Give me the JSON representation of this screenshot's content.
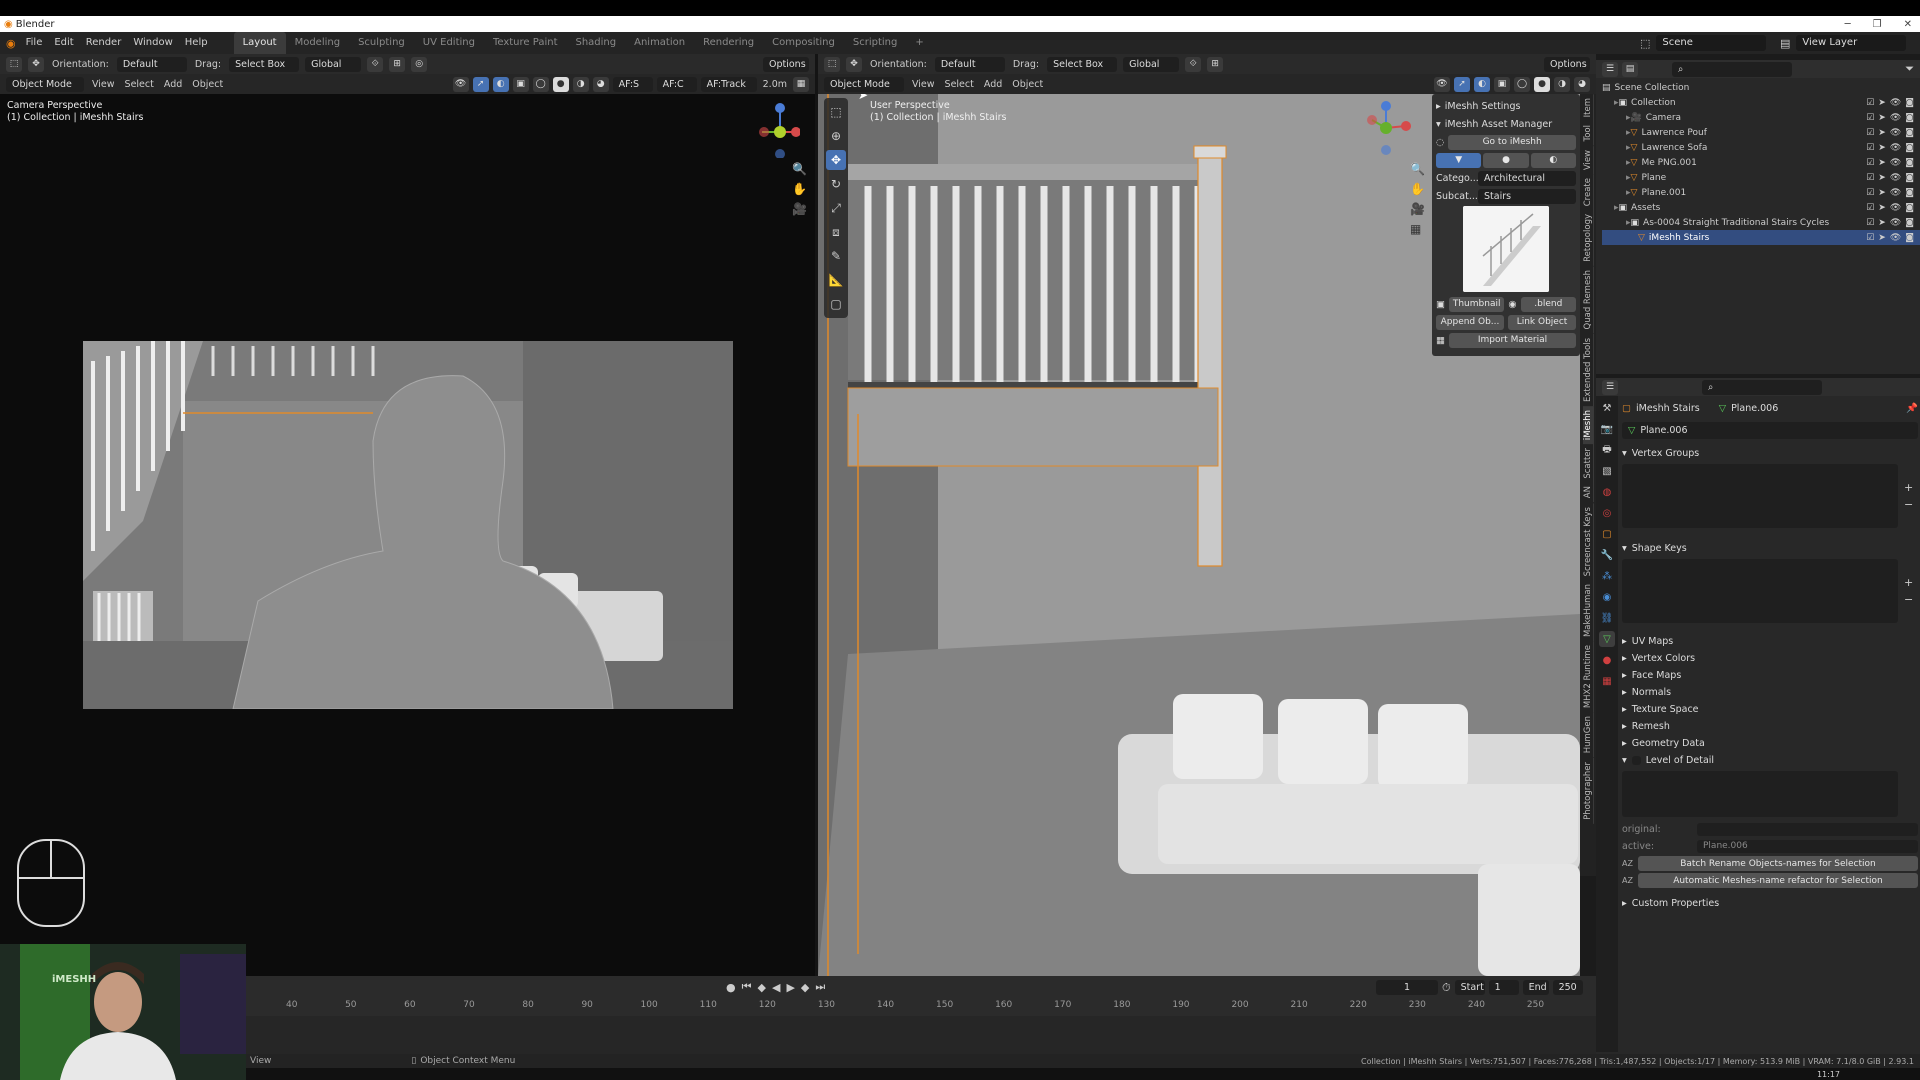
{
  "app": {
    "title": "Blender"
  },
  "menubar": {
    "menus": [
      "File",
      "Edit",
      "Render",
      "Window",
      "Help"
    ],
    "workspaces": [
      "Layout",
      "Modeling",
      "Sculpting",
      "UV Editing",
      "Texture Paint",
      "Shading",
      "Animation",
      "Rendering",
      "Compositing",
      "Scripting",
      "+"
    ],
    "scene": "Scene",
    "view_layer": "View Layer"
  },
  "left_viewport": {
    "header": {
      "orientation_label": "Orientation:",
      "orientation_value": "Default",
      "drag_label": "Drag:",
      "drag_value": "Select Box",
      "transform": "Global",
      "options": "Options"
    },
    "mode": "Object Mode",
    "menus": [
      "View",
      "Select",
      "Add",
      "Object"
    ],
    "af_s": "AF:S",
    "af_c": "AF:C",
    "af_track": "AF:Track",
    "focus_distance": "2.0m",
    "view_name": "Camera Perspective",
    "collection_info": "(1) Collection | iMeshh Stairs"
  },
  "right_viewport": {
    "header": {
      "orientation_label": "Orientation:",
      "orientation_value": "Default",
      "drag_label": "Drag:",
      "drag_value": "Select Box",
      "transform": "Global",
      "options": "Options"
    },
    "mode": "Object Mode",
    "menus": [
      "View",
      "Select",
      "Add",
      "Object"
    ],
    "view_name": "User Perspective",
    "collection_info": "(1) Collection | iMeshh Stairs",
    "side_tabs": [
      "Item",
      "Tool",
      "View",
      "Create",
      "Retopology",
      "Quad Remesh",
      "Extended Tools",
      "iMeshh",
      "Scatter",
      "AN",
      "Screencast Keys",
      "MakeHuman",
      "MHX2 Runtime",
      "HumGen",
      "Photographer"
    ]
  },
  "imeshh_panel": {
    "settings": "iMeshh Settings",
    "asset_manager": "iMeshh Asset Manager",
    "go_button": "Go to iMeshh",
    "category_label": "Catego...",
    "category_value": "Architectural",
    "subcategory_label": "Subcat...",
    "subcategory_value": "Stairs",
    "thumbnail_button": "Thumbnail",
    "blend_button": ".blend",
    "append_button": "Append Ob...",
    "link_button": "Link Object",
    "import_material_button": "Import Material"
  },
  "outliner": {
    "header": "Scene Collection",
    "items": [
      {
        "label": "Collection",
        "icon": "collection-icon",
        "depth": 1,
        "selected": false
      },
      {
        "label": "Camera",
        "icon": "camera-icon",
        "depth": 2,
        "selected": false
      },
      {
        "label": "Lawrence Pouf",
        "icon": "mesh-icon",
        "depth": 2,
        "selected": false
      },
      {
        "label": "Lawrence Sofa",
        "icon": "mesh-icon",
        "depth": 2,
        "selected": false
      },
      {
        "label": "Me PNG.001",
        "icon": "mesh-icon",
        "depth": 2,
        "selected": false
      },
      {
        "label": "Plane",
        "icon": "mesh-icon",
        "depth": 2,
        "selected": false
      },
      {
        "label": "Plane.001",
        "icon": "mesh-icon",
        "depth": 2,
        "selected": false
      },
      {
        "label": "Assets",
        "icon": "collection-icon",
        "depth": 1,
        "selected": false
      },
      {
        "label": "As-0004 Straight Traditional Stairs Cycles",
        "icon": "collection-icon",
        "depth": 2,
        "selected": false
      },
      {
        "label": "iMeshh Stairs",
        "icon": "mesh-icon",
        "depth": 3,
        "selected": true
      }
    ]
  },
  "properties": {
    "object_name": "iMeshh Stairs",
    "mesh_name": "Plane.006",
    "data_name": "Plane.006",
    "sections": {
      "vertex_groups": "Vertex Groups",
      "shape_keys": "Shape Keys",
      "collapsed": [
        "UV Maps",
        "Vertex Colors",
        "Face Maps",
        "Normals",
        "Texture Space",
        "Remesh",
        "Geometry Data"
      ],
      "lod": "Level of Detail",
      "custom": "Custom Properties"
    },
    "original_label": "original:",
    "active_label": "active:",
    "active_value": "Plane.006",
    "batch_rename": "Batch Rename Objects-names for Selection",
    "auto_meshes": "Automatic Meshes-name refactor for Selection"
  },
  "timeline": {
    "current_frame": "1",
    "start_label": "Start",
    "start": "1",
    "end_label": "End",
    "end": "250",
    "ticks": [
      "40",
      "50",
      "60",
      "70",
      "80",
      "90",
      "100",
      "110",
      "120",
      "130",
      "140",
      "150",
      "160",
      "170",
      "180",
      "190",
      "200",
      "210",
      "220",
      "230",
      "240",
      "250"
    ]
  },
  "statusbar": {
    "left": "View",
    "mid": "Object Context Menu",
    "right": "Collection | iMeshh Stairs | Verts:751,507 | Faces:776,268 | Tris:1,487,552 | Objects:1/17 | Memory: 513.9 MiB | VRAM: 7.1/8.0 GiB | 2.93.1"
  },
  "webcam": {
    "logo": "iMESHH"
  },
  "taskbar": {
    "time": "11:17"
  }
}
